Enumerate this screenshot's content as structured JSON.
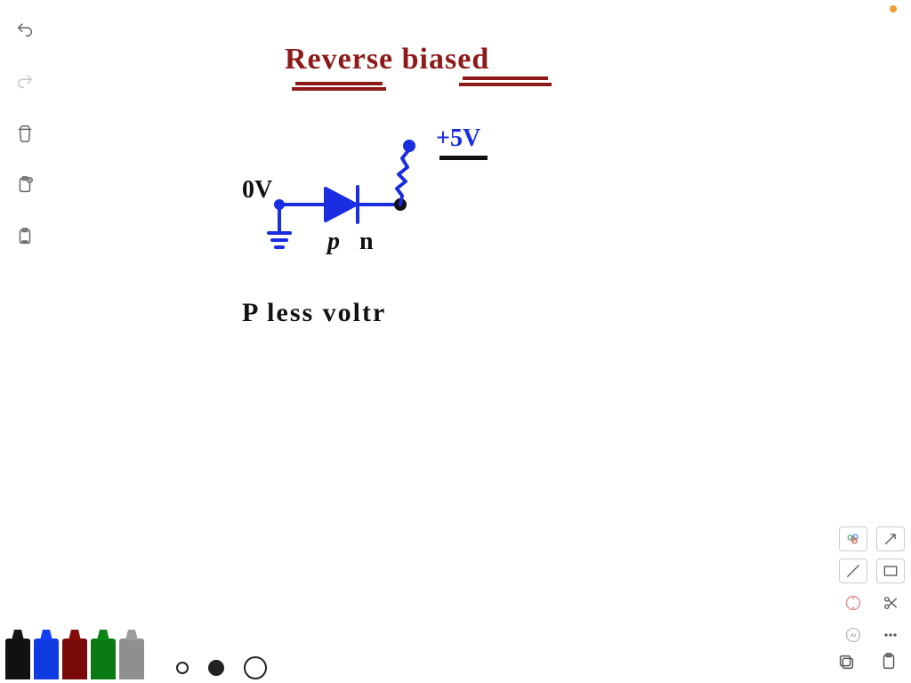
{
  "title": "Reverse biased",
  "circuit": {
    "left_voltage_label": "0V",
    "right_voltage_label": "+5V",
    "anode_label": "p",
    "cathode_label": "n"
  },
  "note": "P  less  voltr",
  "colors": {
    "title": "#8e1a1a",
    "circuit_stroke": "#1a2de0",
    "ink": "#111111"
  },
  "palette": {
    "markers": [
      "black",
      "blue",
      "red",
      "green",
      "gray"
    ],
    "stroke_sizes": [
      "small-open",
      "medium-filled",
      "large-open"
    ]
  },
  "right_palette": {
    "items": [
      "photos",
      "arrow",
      "line",
      "rectangle",
      "compass",
      "scissors",
      "ai",
      "more"
    ]
  },
  "left_tools": {
    "undo": "undo",
    "redo": "redo",
    "trash": "trash",
    "paste_plus": "clipboard-plus",
    "paste_more": "clipboard-more"
  },
  "bottom_right": {
    "stack": "stack",
    "clipboard": "clipboard"
  }
}
